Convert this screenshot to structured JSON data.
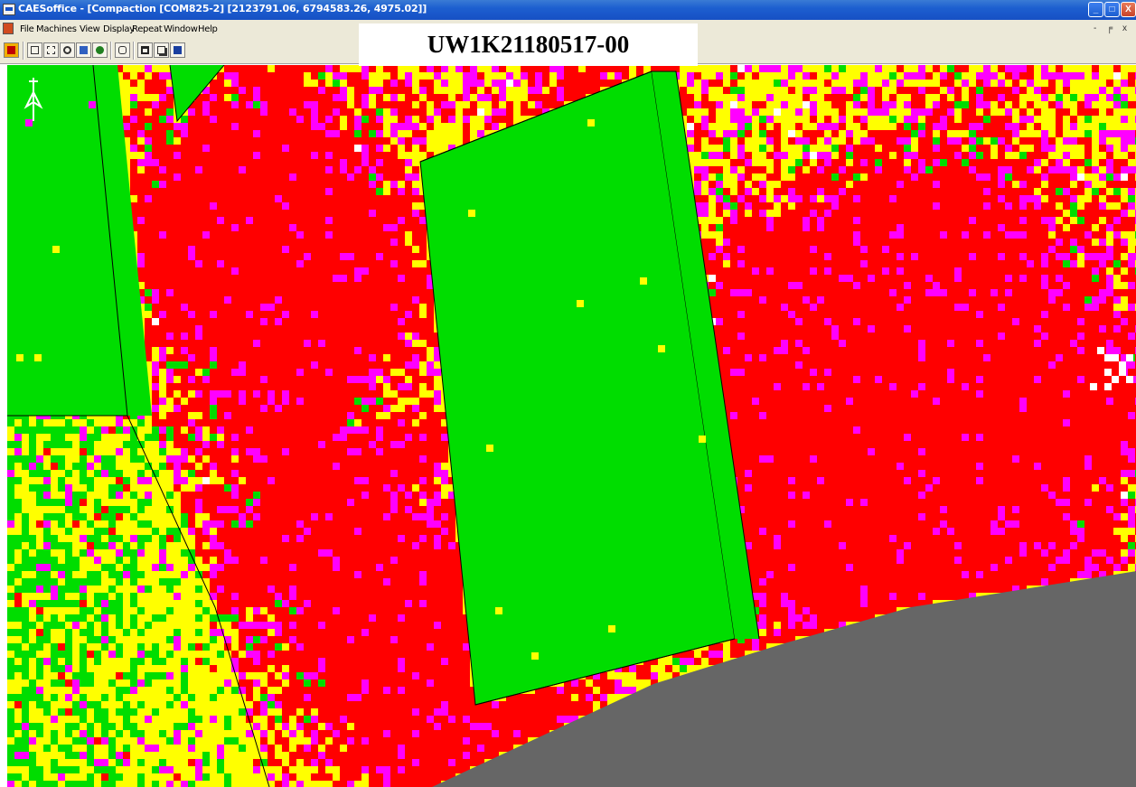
{
  "window": {
    "title": "CAESoffice - [Compaction  [COM825-2]     [2123791.06, 6794583.26, 4975.02]]",
    "caption_buttons": {
      "minimize": "_",
      "maximize": "□",
      "close": "X"
    }
  },
  "menubar": {
    "items": [
      "File",
      "Machines",
      "View",
      "Display",
      "Repeat",
      "Window",
      "Help"
    ],
    "mdi_controls": "- ╒ x"
  },
  "toolbar": {
    "buttons": [
      "report-icon",
      "zoom-extents-icon",
      "zoom-window-icon",
      "zoom-in-icon",
      "zoom-out-icon",
      "undo-zoom-icon",
      "redo-icon",
      "layers-icon",
      "copy-icon",
      "help-pointer-icon"
    ]
  },
  "job_label": "UW1K21180517-00",
  "map": {
    "colors": {
      "background": "#ffff00",
      "high_pass": "#00dd00",
      "medium": "#ff00ff",
      "low": "#ff0000",
      "no_data": "#666666",
      "boundary": "#000000",
      "blank": "#ffffff"
    },
    "north_arrow": "north-arrow-icon",
    "seed": 1337
  }
}
